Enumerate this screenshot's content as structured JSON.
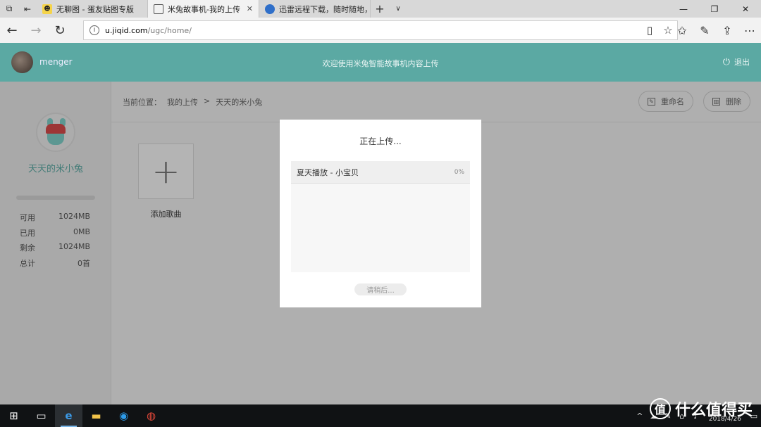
{
  "browser": {
    "tabs": [
      {
        "title": "无聊图 - 蛋友贴图专版",
        "active": false
      },
      {
        "title": "米兔故事机-我的上传",
        "active": true
      },
      {
        "title": "迅雷远程下载，随时随地，",
        "active": false
      }
    ],
    "url_host": "u.jiqid.com",
    "url_path": "/ugc/home/"
  },
  "header": {
    "username": "menger",
    "welcome": "欢迎使用米兔智能故事机内容上传",
    "logout": "退出"
  },
  "sidebar": {
    "nickname": "天天的米小兔",
    "stats": [
      {
        "label": "可用",
        "value": "1024MB"
      },
      {
        "label": "已用",
        "value": "0MB"
      },
      {
        "label": "剩余",
        "value": "1024MB"
      },
      {
        "label": "总计",
        "value": "0首"
      }
    ]
  },
  "main": {
    "breadcrumb_prefix": "当前位置：",
    "breadcrumb_parent": "我的上传",
    "breadcrumb_sep": ">",
    "breadcrumb_current": "天天的米小兔",
    "rename": "重命名",
    "delete": "删除",
    "add_song": "添加歌曲"
  },
  "dialog": {
    "title": "正在上传...",
    "item_name": "夏天播放 - 小宝贝",
    "item_progress": "0%",
    "wait_button": "请稍后..."
  },
  "taskbar": {
    "date": "2018/4/26"
  },
  "watermark": "什么值得买",
  "colors": {
    "brand_teal": "#5ba9a3"
  }
}
